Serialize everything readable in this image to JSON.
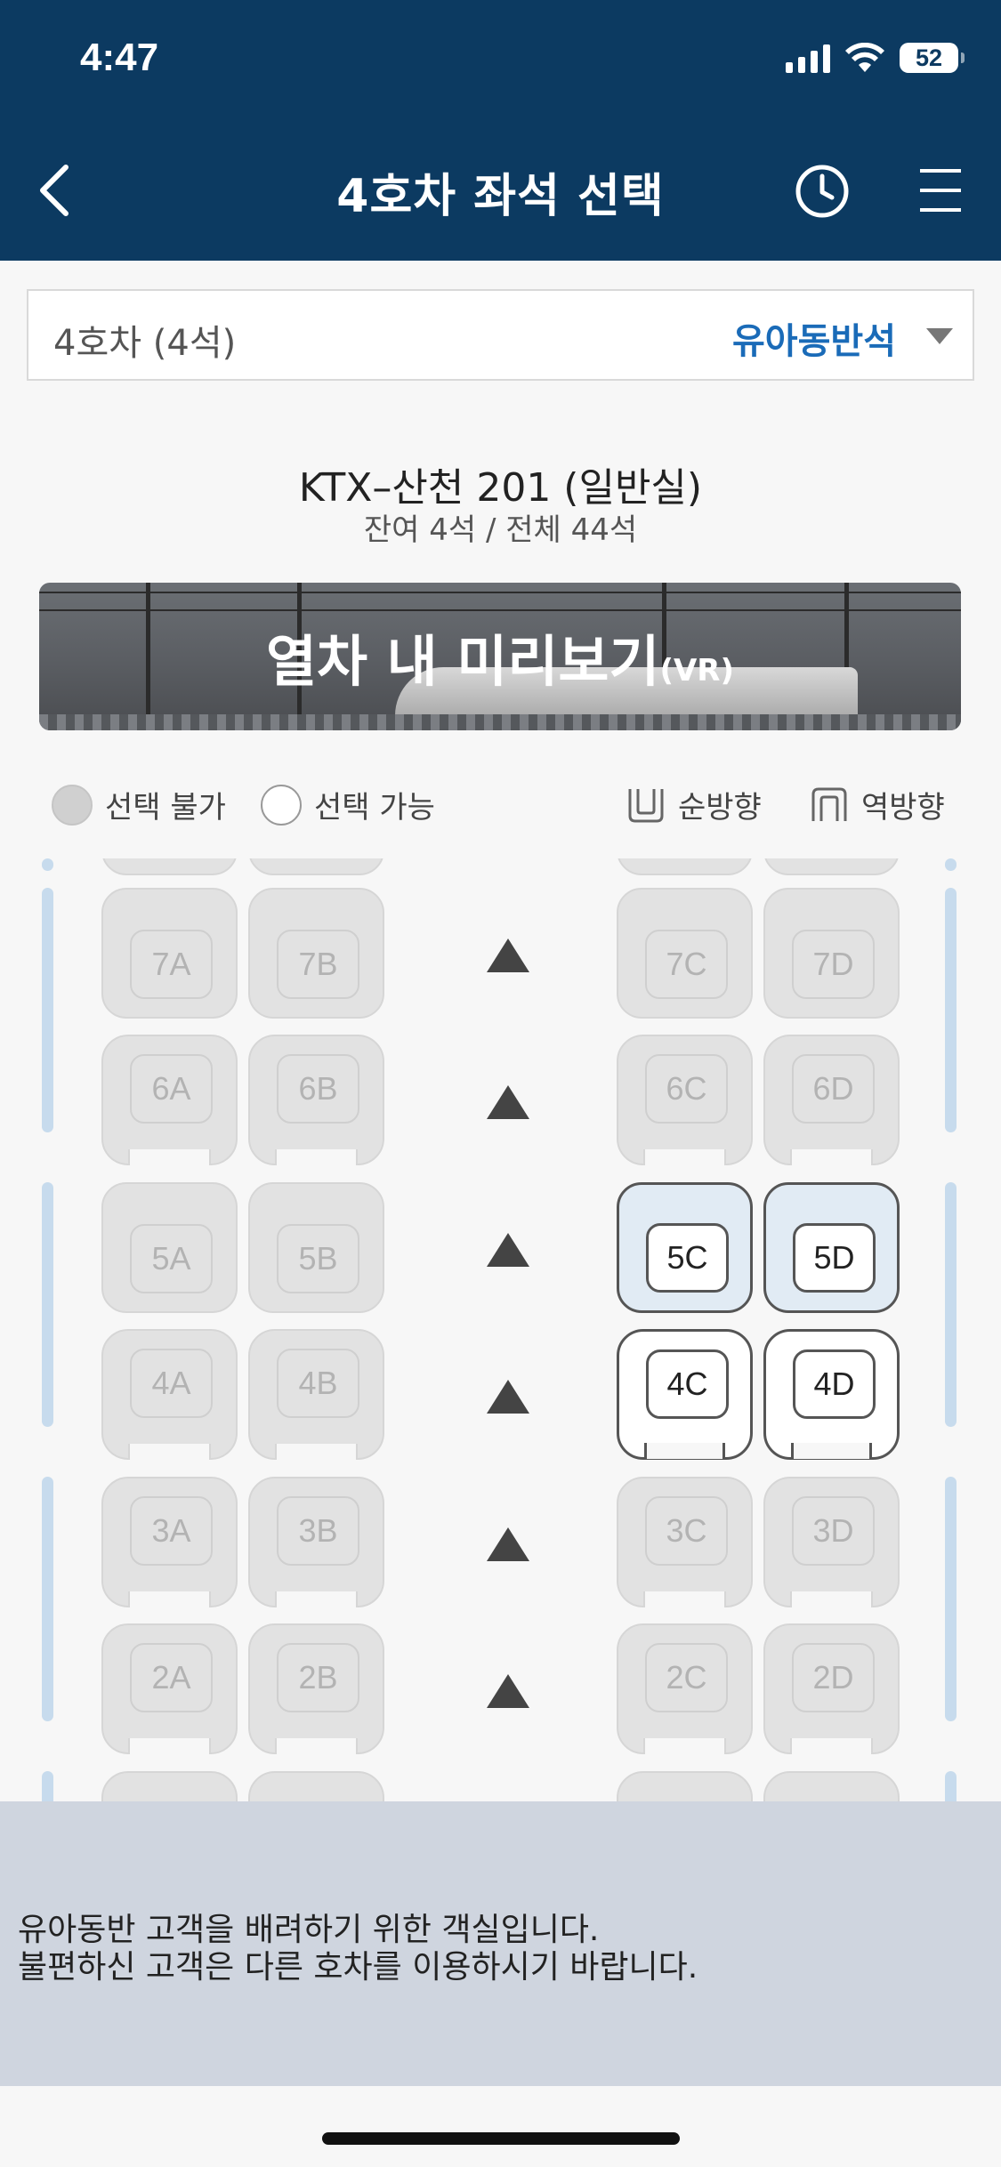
{
  "status_bar": {
    "time": "4:47",
    "battery": "52"
  },
  "header": {
    "title": "4호차 좌석 선택"
  },
  "car_selector": {
    "car": "4호차 (4석)",
    "car_type": "유아동반석"
  },
  "train": {
    "name": "KTX–산천 201 (일반실)",
    "seats_summary": "잔여 4석 / 전체 44석"
  },
  "vr_banner": {
    "title": "열차 내 미리보기",
    "suffix": "(VR)"
  },
  "legend": {
    "unavailable": "선택 불가",
    "available": "선택 가능",
    "forward": "순방향",
    "reverse": "역방향"
  },
  "seats": {
    "row7": [
      "7A",
      "7B",
      "7C",
      "7D"
    ],
    "row6": [
      "6A",
      "6B",
      "6C",
      "6D"
    ],
    "row5": [
      "5A",
      "5B",
      "5C",
      "5D"
    ],
    "row4": [
      "4A",
      "4B",
      "4C",
      "4D"
    ],
    "row3": [
      "3A",
      "3B",
      "3C",
      "3D"
    ],
    "row2": [
      "2A",
      "2B",
      "2C",
      "2D"
    ]
  },
  "available_seats": [
    "5C",
    "5D",
    "4C",
    "4D"
  ],
  "notice": {
    "line1": "유아동반 고객을 배려하기 위한 객실입니다.",
    "line2": "불편하신 고객은 다른 호차를 이용하시기 바랍니다."
  },
  "colors": {
    "header_bg": "#0c3a61",
    "accent": "#1a6bb8",
    "notice_bg": "#cfd5df"
  },
  "icons": {
    "back": "chevron-left-icon",
    "history": "clock-icon",
    "menu": "hamburger-icon"
  }
}
